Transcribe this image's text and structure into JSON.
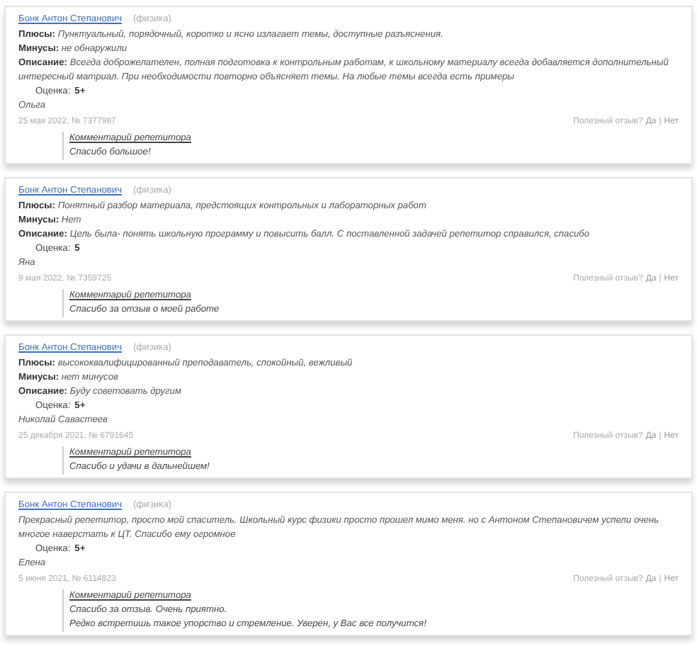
{
  "reviews": [
    {
      "tutor": "Бонк Антон Степанович",
      "subject": "(физика)",
      "fields": [
        {
          "label": "Плюсы:",
          "text": "Пунктуальный, порядочный, коротко и ясно излагает темы, доступные разъяснения."
        },
        {
          "label": "Минусы:",
          "text": "не обнаружили"
        },
        {
          "label": "Описание:",
          "text": "Всегда доброжелателен, полная подготовка к контрольным работам, к школьному материалу всегда добавляется дополнительный интересный матриал. При необходимости повторно объясняет темы. На любые темы всегда есть примеры"
        }
      ],
      "rating_label": "Оценка:",
      "rating": "5+",
      "author": "Ольга",
      "meta": "25 мая 2022, № 7377987",
      "helpful": "Полезный отзыв?",
      "yes": "Да",
      "sep": "|",
      "no": "Нет",
      "comment_title": "Комментарий репетитора",
      "comment_lines": [
        "Спасибо большое!"
      ]
    },
    {
      "tutor": "Бонк Антон Степанович",
      "subject": "(физика)",
      "fields": [
        {
          "label": "Плюсы:",
          "text": "Понятный разбор материала, предстоящих контрольных и лабораторных работ"
        },
        {
          "label": "Минусы:",
          "text": "Нет"
        },
        {
          "label": "Описание:",
          "text": "Цель была- понять школьную программу и повысить балл. С поставленной задачей репетитор справился, спасибо"
        }
      ],
      "rating_label": "Оценка:",
      "rating": "5",
      "author": "Яна",
      "meta": "9 мая 2022, № 7359725",
      "helpful": "Полезный отзыв?",
      "yes": "Да",
      "sep": "|",
      "no": "Нет",
      "comment_title": "Комментарий репетитора",
      "comment_lines": [
        "Спасибо за отзыв о моей работе"
      ]
    },
    {
      "tutor": "Бонк Антон Степанович",
      "subject": "(физика)",
      "fields": [
        {
          "label": "Плюсы:",
          "text": "высококвалифицированный преподаватель, спокойный, вежливый"
        },
        {
          "label": "Минусы:",
          "text": "нет минусов"
        },
        {
          "label": "Описание:",
          "text": "Буду советовать другим"
        }
      ],
      "rating_label": "Оценка:",
      "rating": "5+",
      "author": "Николай Савастеев",
      "meta": "25 декабря 2021, № 6791645",
      "helpful": "Полезный отзыв?",
      "yes": "Да",
      "sep": "|",
      "no": "Нет",
      "comment_title": "Комментарий репетитора",
      "comment_lines": [
        "Спасибо и удачи в дальнейшем!"
      ]
    },
    {
      "tutor": "Бонк Антон Степанович",
      "subject": "(физика)",
      "fields": [
        {
          "text": "Прекрасный репетитор, просто мой спаситель. Школьный курс физики просто прошел мимо меня. но с Антоном Степановичем успели очень многое наверстать к ЦТ. Спасибо ему огромное"
        }
      ],
      "rating_label": "Оценка:",
      "rating": "5+",
      "author": "Елена",
      "meta": "5 июня 2021, № 6114823",
      "helpful": "Полезный отзыв?",
      "yes": "Да",
      "sep": "|",
      "no": "Нет",
      "comment_title": "Комментарий репетитора",
      "comment_lines": [
        "Спасибо за отзыв. Очень приятно.",
        "Редко встретишь такое упорство и стремление. Уверен, у Вас все получится!"
      ]
    }
  ]
}
